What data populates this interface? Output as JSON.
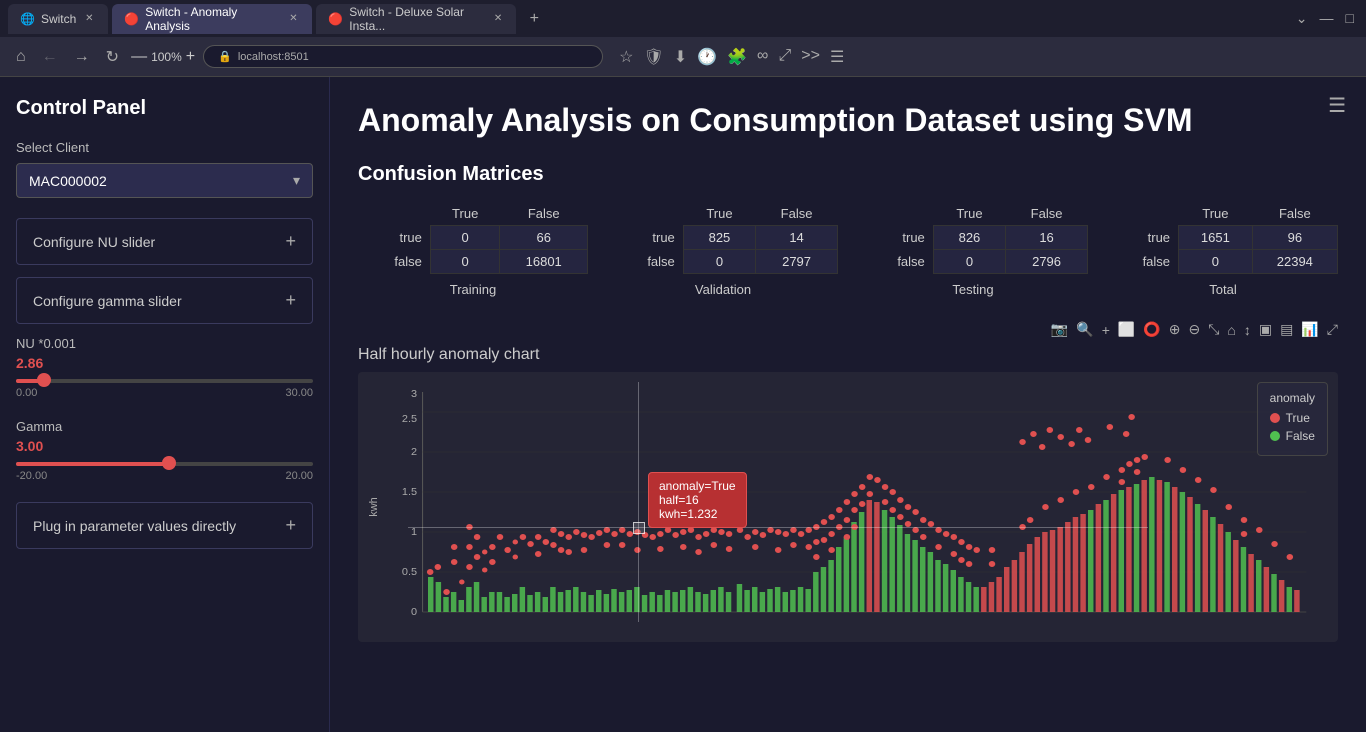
{
  "browser": {
    "tabs": [
      {
        "id": "tab1",
        "label": "Switch",
        "url": "",
        "active": false,
        "icon": "🌐"
      },
      {
        "id": "tab2",
        "label": "Switch - Anomaly Analysis",
        "url": "localhost:8501",
        "active": true,
        "icon": "🔴"
      },
      {
        "id": "tab3",
        "label": "Switch - Deluxe Solar Insta...",
        "url": "",
        "active": false,
        "icon": "🔴"
      }
    ],
    "url": "localhost:8501",
    "zoom": "100%"
  },
  "sidebar": {
    "title": "Control Panel",
    "select_label": "Select Client",
    "selected_client": "MAC000002",
    "accordion_items": [
      {
        "label": "Configure NU slider"
      },
      {
        "label": "Configure gamma slider"
      },
      {
        "label": "Plug in parameter values directly"
      }
    ],
    "nu_label": "NU *0.001",
    "nu_value": "2.86",
    "nu_min": "0.00",
    "nu_max": "30.00",
    "gamma_label": "Gamma",
    "gamma_value": "3.00",
    "gamma_min": "-20.00",
    "gamma_max": "20.00"
  },
  "main": {
    "title": "Anomaly Analysis on Consumption Dataset using SVM",
    "confusion_title": "Confusion Matrices",
    "matrices": [
      {
        "label": "Training",
        "headers": [
          "",
          "True",
          "False"
        ],
        "rows": [
          {
            "label": "true",
            "vals": [
              "0",
              "66"
            ]
          },
          {
            "label": "false",
            "vals": [
              "0",
              "16801"
            ]
          }
        ]
      },
      {
        "label": "Validation",
        "headers": [
          "",
          "True",
          "False"
        ],
        "rows": [
          {
            "label": "true",
            "vals": [
              "825",
              "14"
            ]
          },
          {
            "label": "false",
            "vals": [
              "0",
              "2797"
            ]
          }
        ]
      },
      {
        "label": "Testing",
        "headers": [
          "",
          "True",
          "False"
        ],
        "rows": [
          {
            "label": "true",
            "vals": [
              "826",
              "16"
            ]
          },
          {
            "label": "false",
            "vals": [
              "0",
              "2796"
            ]
          }
        ]
      },
      {
        "label": "Total",
        "headers": [
          "",
          "True",
          "False"
        ],
        "rows": [
          {
            "label": "true",
            "vals": [
              "1651",
              "96"
            ]
          },
          {
            "label": "false",
            "vals": [
              "0",
              "22394"
            ]
          }
        ]
      }
    ],
    "chart_title": "Half hourly anomaly chart",
    "chart_yaxis_label": "kwh",
    "chart_yaxis_ticks": [
      "3",
      "2.5",
      "2",
      "1.5",
      "1",
      "0.5",
      "0"
    ],
    "legend": {
      "title": "anomaly",
      "items": [
        {
          "label": "True",
          "color": "red"
        },
        {
          "label": "False",
          "color": "green"
        }
      ]
    },
    "tooltip": {
      "line1": "anomaly=True",
      "line2": "half=16",
      "line3": "kwh=1.232"
    }
  }
}
